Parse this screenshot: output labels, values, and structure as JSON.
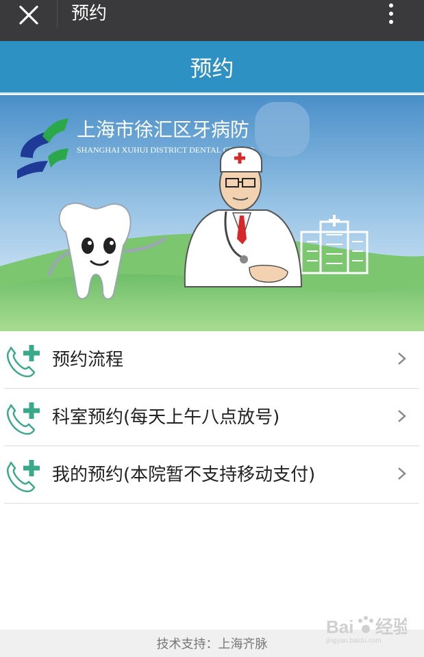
{
  "topbar": {
    "title": "预约",
    "close_icon": "close-icon",
    "more_icon": "more-vertical-icon",
    "background": "#3a3a3c"
  },
  "header": {
    "title": "预约",
    "background": "#2e91c4"
  },
  "banner": {
    "hospital_name_cn": "上海市徐汇区牙病防",
    "hospital_name_en": "SHANGHAI XUHUI DISTRICT DENTAL CENTER",
    "logo_icon": "hospital-logo",
    "illustrations": [
      "tooth-character",
      "doctor-character",
      "hospital-building"
    ]
  },
  "menu": {
    "items": [
      {
        "label": "预约流程",
        "icon": "phone-plus-icon",
        "accent": "#3aa88a"
      },
      {
        "label": "科室预约(每天上午八点放号)",
        "icon": "phone-plus-icon",
        "accent": "#3aa88a"
      },
      {
        "label": "我的预约(本院暂不支持移动支付)",
        "icon": "phone-plus-icon",
        "accent": "#3aa88a"
      }
    ]
  },
  "footer": {
    "text": "技术支持：上海齐脉"
  },
  "watermark": {
    "text": "Bai",
    "sub": "jingyan.baidu.com"
  }
}
